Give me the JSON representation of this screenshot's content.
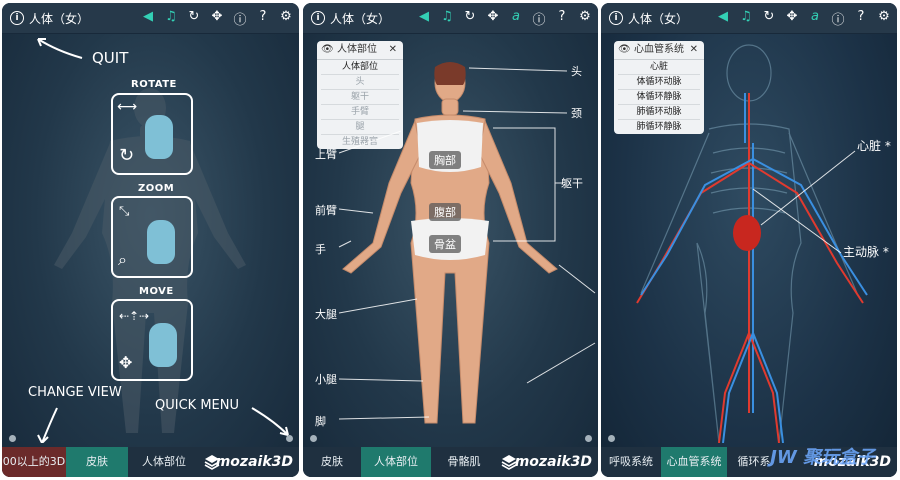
{
  "panel1": {
    "title": "人体（女）",
    "annotations": {
      "quit": "QUIT",
      "change_view": "CHANGE VIEW",
      "quick_menu": "QUICK MENU"
    },
    "gestures": [
      {
        "label": "ROTATE"
      },
      {
        "label": "ZOOM"
      },
      {
        "label": "MOVE"
      }
    ],
    "bottom": {
      "left": "00以上的3D",
      "mid": "皮肤",
      "right": "人体部位"
    },
    "brand": "mozaik3D"
  },
  "panel2": {
    "title": "人体（女）",
    "popup": {
      "title": "人体部位",
      "items": [
        "人体部位",
        "头",
        "躯干",
        "手臂",
        "腿",
        "生殖器官"
      ]
    },
    "labels_left": [
      "上臂",
      "前臂",
      "手",
      "大腿",
      "小腿",
      "脚"
    ],
    "labels_right": [
      "头",
      "颈",
      "躯干"
    ],
    "tags": [
      "胸部",
      "腹部",
      "骨盆"
    ],
    "bottom": {
      "left": "皮肤",
      "mid": "人体部位",
      "right": "骨骼肌"
    },
    "brand": "mozaik3D"
  },
  "panel3": {
    "title": "人体（女）",
    "popup": {
      "title": "心血管系统",
      "items": [
        "心脏",
        "体循环动脉",
        "体循环静脉",
        "肺循环动脉",
        "肺循环静脉"
      ]
    },
    "labels_right": [
      "心脏 *",
      "主动脉 *"
    ],
    "bottom": {
      "left": "呼吸系统",
      "mid": "心血管系统",
      "right": "循环系"
    },
    "brand": "mozaik3D",
    "watermark": "JW 聚玩盒子"
  },
  "colors": {
    "accent": "#33d0b5",
    "active_tab": "#1f7a6d",
    "artery": "#e03a2f",
    "vein": "#3a8fe0"
  }
}
